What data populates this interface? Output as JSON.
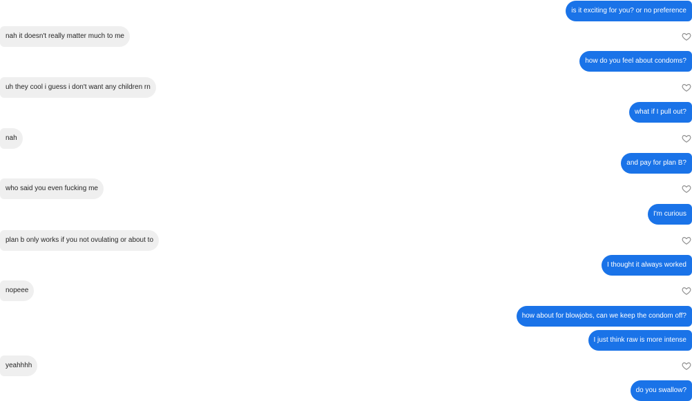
{
  "conversation": {
    "messages": [
      {
        "sender": "me",
        "text": "is it exciting for you? or no preference"
      },
      {
        "sender": "them",
        "text": "nah it doesn't really matter much to me"
      },
      {
        "sender": "me",
        "text": "how do you feel about condoms?"
      },
      {
        "sender": "them",
        "text": "uh they cool i guess i don't want any children rn"
      },
      {
        "sender": "me",
        "text": "what if I pull out?"
      },
      {
        "sender": "them",
        "text": "nah"
      },
      {
        "sender": "me",
        "text": "and pay for plan B?"
      },
      {
        "sender": "them",
        "text": "who said you even fucking me"
      },
      {
        "sender": "me",
        "text": "I'm curious"
      },
      {
        "sender": "them",
        "text": "plan b only works if you not ovulating or about to"
      },
      {
        "sender": "me",
        "text": "I thought it always worked"
      },
      {
        "sender": "them",
        "text": "nopeee"
      },
      {
        "sender": "me",
        "text": "how about for blowjobs, can we keep the condom off?"
      },
      {
        "sender": "me",
        "text": "I just think raw is more intense"
      },
      {
        "sender": "them",
        "text": "yeahhhh"
      },
      {
        "sender": "me",
        "text": "do you swallow?"
      }
    ]
  },
  "icons": {
    "like": "heart-outline-icon"
  },
  "colors": {
    "outgoing_bubble": "#1a73e8",
    "incoming_bubble": "#efefef",
    "outgoing_text": "#ffffff",
    "incoming_text": "#262626",
    "heart_outline": "#8e8e8e"
  }
}
